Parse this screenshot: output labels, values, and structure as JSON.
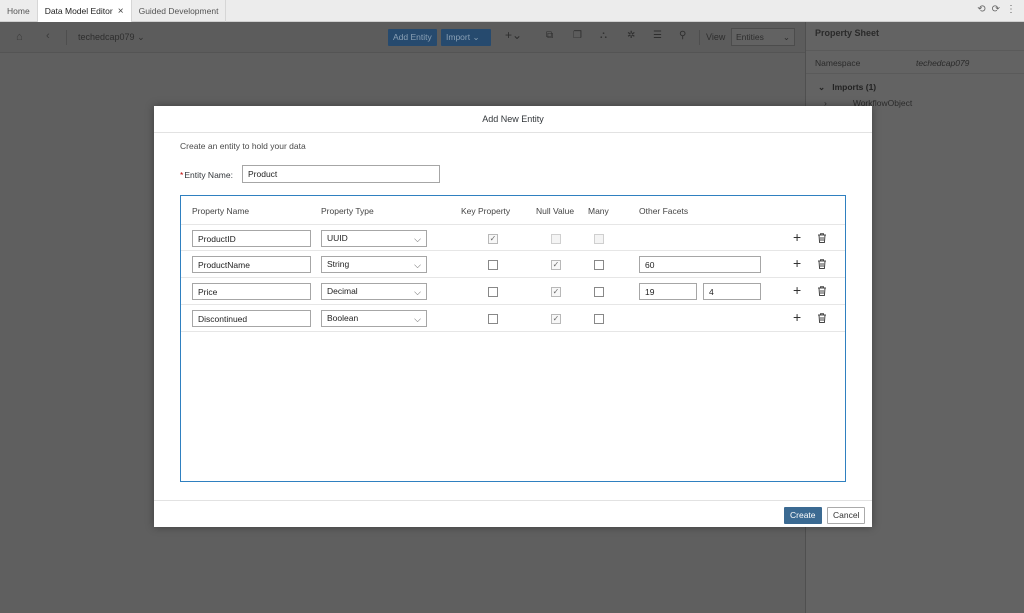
{
  "tabs": [
    {
      "label": "Home"
    },
    {
      "label": "Data Model Editor",
      "close": "×"
    },
    {
      "label": "Guided Development"
    }
  ],
  "toolbar": {
    "namespace": "techedcap079",
    "add_entity": "Add Entity",
    "import": "Import",
    "view_label": "View",
    "view_value": "Entities"
  },
  "property_sheet": {
    "title": "Property Sheet",
    "namespace_label": "Namespace",
    "namespace_value": "techedcap079",
    "imports": "Imports (1)",
    "import_item": "WorkflowObject"
  },
  "dialog": {
    "title": "Add New Entity",
    "description": "Create an entity to hold your data",
    "entity_name_label": "Entity Name:",
    "entity_name_value": "Product",
    "columns": {
      "property_name": "Property Name",
      "property_type": "Property Type",
      "key_property": "Key Property",
      "null_value": "Null Value",
      "many": "Many",
      "other_facets": "Other Facets"
    },
    "rows": [
      {
        "name": "ProductID",
        "type": "UUID",
        "key": true,
        "null": false,
        "many": false,
        "facet1": "",
        "facet2": ""
      },
      {
        "name": "ProductName",
        "type": "String",
        "key": false,
        "null": true,
        "many": false,
        "facet1": "60",
        "facet2": ""
      },
      {
        "name": "Price",
        "type": "Decimal",
        "key": false,
        "null": true,
        "many": false,
        "facet1": "19",
        "facet2": "4"
      },
      {
        "name": "Discontinued",
        "type": "Boolean",
        "key": false,
        "null": true,
        "many": false,
        "facet1": "",
        "facet2": ""
      }
    ],
    "create_label": "Create",
    "cancel_label": "Cancel"
  }
}
